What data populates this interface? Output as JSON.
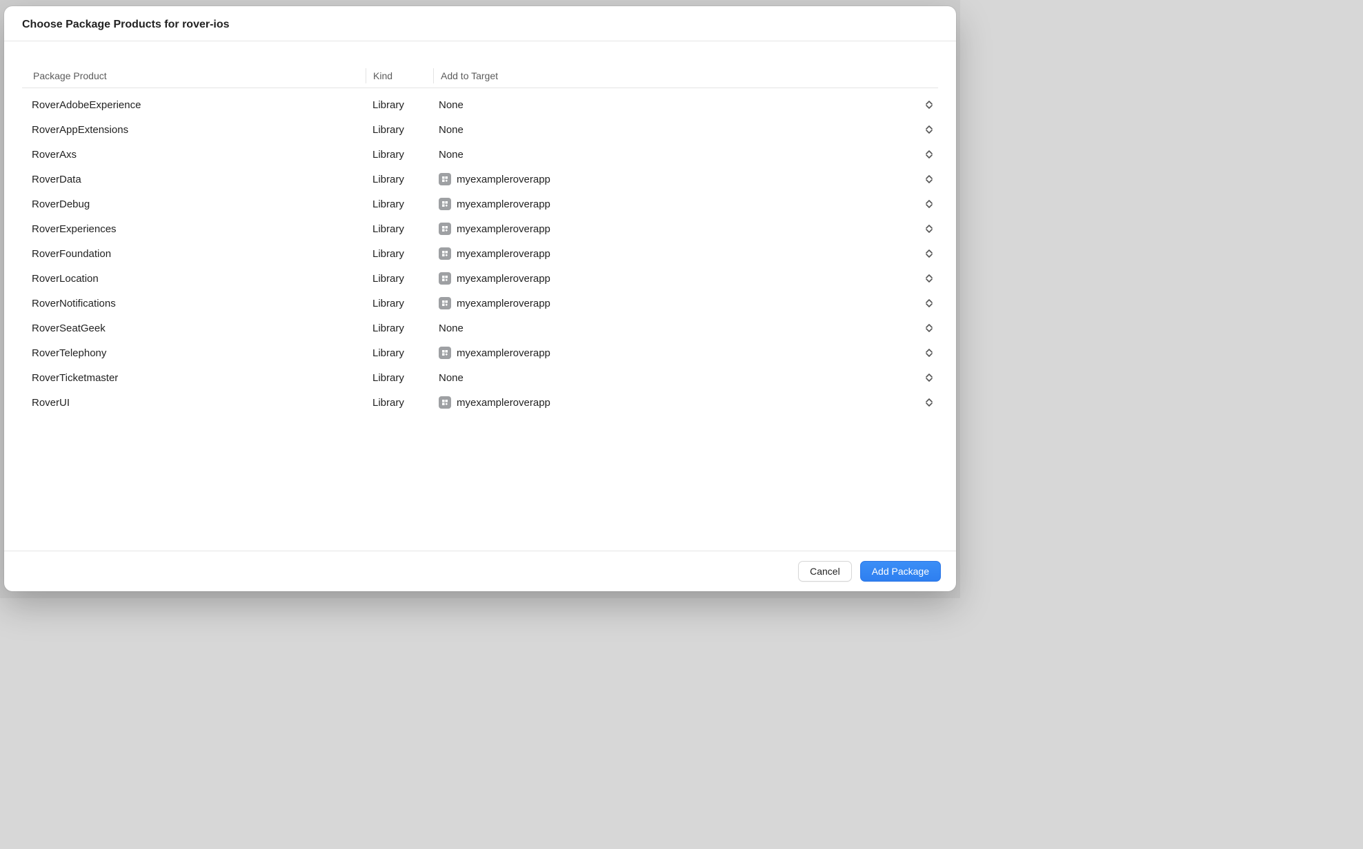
{
  "dialog": {
    "title": "Choose Package Products for rover-ios",
    "columns": {
      "product": "Package Product",
      "kind": "Kind",
      "target": "Add to Target"
    },
    "buttons": {
      "cancel": "Cancel",
      "add": "Add Package"
    }
  },
  "target_app_name": "myexampleroverapp",
  "none_label": "None",
  "products": [
    {
      "name": "RoverAdobeExperience",
      "kind": "Library",
      "target": "None"
    },
    {
      "name": "RoverAppExtensions",
      "kind": "Library",
      "target": "None"
    },
    {
      "name": "RoverAxs",
      "kind": "Library",
      "target": "None"
    },
    {
      "name": "RoverData",
      "kind": "Library",
      "target": "myexampleroverapp"
    },
    {
      "name": "RoverDebug",
      "kind": "Library",
      "target": "myexampleroverapp"
    },
    {
      "name": "RoverExperiences",
      "kind": "Library",
      "target": "myexampleroverapp"
    },
    {
      "name": "RoverFoundation",
      "kind": "Library",
      "target": "myexampleroverapp"
    },
    {
      "name": "RoverLocation",
      "kind": "Library",
      "target": "myexampleroverapp"
    },
    {
      "name": "RoverNotifications",
      "kind": "Library",
      "target": "myexampleroverapp"
    },
    {
      "name": "RoverSeatGeek",
      "kind": "Library",
      "target": "None"
    },
    {
      "name": "RoverTelephony",
      "kind": "Library",
      "target": "myexampleroverapp"
    },
    {
      "name": "RoverTicketmaster",
      "kind": "Library",
      "target": "None"
    },
    {
      "name": "RoverUI",
      "kind": "Library",
      "target": "myexampleroverapp"
    }
  ]
}
